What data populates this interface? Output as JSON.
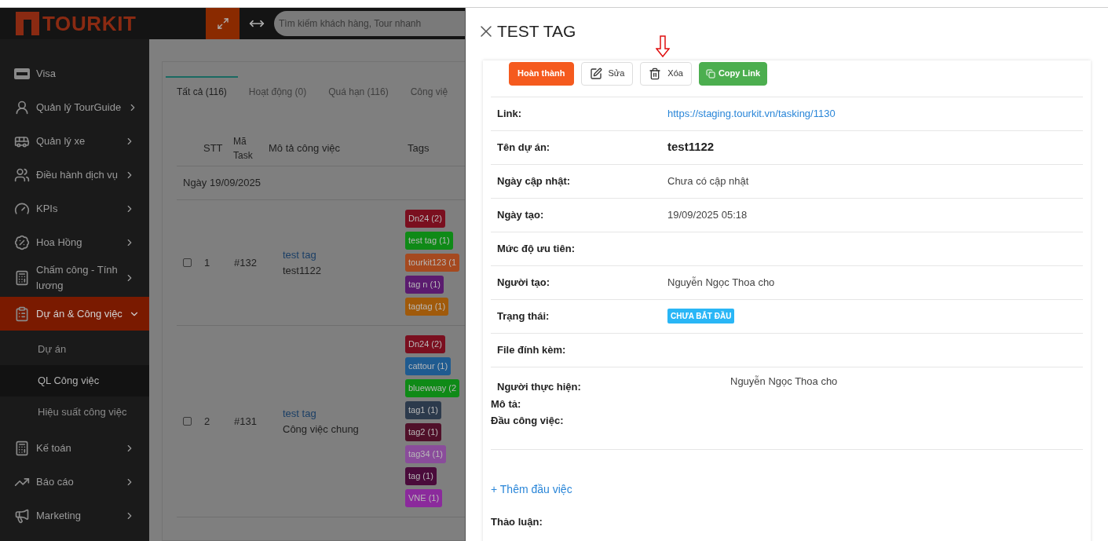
{
  "brand": {
    "name": "TOURKIT"
  },
  "search": {
    "placeholder": "Tìm kiếm khách hàng, Tour nhanh"
  },
  "sidebar": {
    "items": [
      {
        "label": "Visa",
        "kind": "link",
        "selected": false
      },
      {
        "label": "Quản lý TourGuide",
        "kind": "group",
        "selected": false,
        "expanded": false
      },
      {
        "label": "Quản lý xe",
        "kind": "group",
        "selected": false,
        "expanded": false
      },
      {
        "label": "Điều hành dịch vụ",
        "kind": "group",
        "selected": false,
        "expanded": false
      },
      {
        "label": "KPIs",
        "kind": "group",
        "selected": false,
        "expanded": false
      },
      {
        "label": "Hoa Hồng",
        "kind": "group",
        "selected": false,
        "expanded": false
      },
      {
        "label": "Chấm công - Tính lương",
        "kind": "group",
        "selected": false,
        "expanded": false
      },
      {
        "label": "Dự án & Công việc",
        "kind": "group",
        "selected": true,
        "expanded": true,
        "children": [
          {
            "label": "Dự án",
            "selected": false
          },
          {
            "label": "QL Công việc",
            "selected": true
          },
          {
            "label": "Hiệu suất công việc",
            "selected": false
          }
        ]
      },
      {
        "label": "Kế toán",
        "kind": "group",
        "selected": false,
        "expanded": false
      },
      {
        "label": "Báo cáo",
        "kind": "group",
        "selected": false,
        "expanded": false
      },
      {
        "label": "Marketing",
        "kind": "group",
        "selected": false,
        "expanded": false
      }
    ]
  },
  "tabs": [
    {
      "label": "Tất cả (116)",
      "selected": true
    },
    {
      "label": "Hoạt động (0)",
      "selected": false
    },
    {
      "label": "Quá hạn (116)",
      "selected": false
    },
    {
      "label": "Công việ",
      "selected": false
    }
  ],
  "table": {
    "columns": [
      "STT",
      "Mã Task",
      "Mô tả công việc",
      "Tags"
    ],
    "group_label": "Ngày 19/09/2025",
    "rows": [
      {
        "checked": false,
        "stt": "1",
        "code": "#132",
        "title": "test tag",
        "project": "test1122",
        "tags": [
          {
            "label": "Dn24 (2)",
            "color": "#7a0f1f"
          },
          {
            "label": "test tag (1)",
            "color": "#0f8a17"
          },
          {
            "label": "tourkit123 (1",
            "color": "#a5491f"
          },
          {
            "label": "tag n (1)",
            "color": "#5b1b6f"
          },
          {
            "label": "tagtag (1)",
            "color": "#a05a0b"
          }
        ]
      },
      {
        "checked": false,
        "stt": "2",
        "code": "#131",
        "title": "test tag",
        "project": "Công việc chung",
        "tags": [
          {
            "label": "Dn24 (2)",
            "color": "#7a0f1f"
          },
          {
            "label": "cattour (1)",
            "color": "#1f5b90"
          },
          {
            "label": "bluewway (2",
            "color": "#0f8a17"
          },
          {
            "label": "tag1 (1)",
            "color": "#2c3a4c"
          },
          {
            "label": "tag2 (1)",
            "color": "#501029"
          },
          {
            "label": "tag34 (1)",
            "color": "#8a4c9b"
          },
          {
            "label": "tag (1)",
            "color": "#4a0b3b"
          },
          {
            "label": "VNE (1)",
            "color": "#8b2a9c"
          }
        ]
      }
    ]
  },
  "drawer": {
    "title": "TEST TAG",
    "actions": [
      {
        "label": "Hoàn thành",
        "kind": "complete"
      },
      {
        "label": "Sửa",
        "kind": "edit"
      },
      {
        "label": "Xóa",
        "kind": "delete"
      },
      {
        "label": "Copy Link",
        "kind": "copy"
      }
    ],
    "fields": [
      {
        "label": "Link:",
        "kind": "link",
        "value": "https://staging.tourkit.vn/tasking/1130"
      },
      {
        "label": "Tên dự án:",
        "kind": "bold",
        "value": "test1122"
      },
      {
        "label": "Ngày cập nhật:",
        "kind": "text",
        "value": "Chưa có cập nhật"
      },
      {
        "label": "Ngày tạo:",
        "kind": "text",
        "value": "19/09/2025 05:18"
      },
      {
        "label": "Mức độ ưu tiên:",
        "kind": "empty"
      },
      {
        "label": "Người tạo:",
        "kind": "text",
        "value": "Nguyễn Ngọc Thoa cho"
      },
      {
        "label": "Trạng thái:",
        "kind": "badge",
        "value": "CHƯA BẮT ĐẦU"
      },
      {
        "label": "File đính kèm:",
        "kind": "empty"
      },
      {
        "label": "Người thực hiện:",
        "kind": "assignee",
        "value": "Nguyễn Ngọc Thoa cho"
      }
    ],
    "description_label": "Mô tả:",
    "subtasks_label": "Đầu công việc:",
    "add_subtask": "+ Thêm đầu việc",
    "discussion_label": "Thảo luận:"
  }
}
